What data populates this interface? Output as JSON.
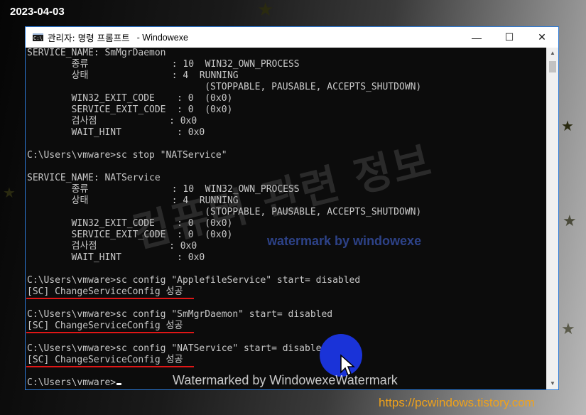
{
  "overlay": {
    "date": "2023-04-03",
    "watermark_korean": "컴퓨터 관련 정보",
    "watermark_blue": "watermark by windowexe",
    "watermark_bottom": "Watermarked by WindowexeWatermark",
    "site_url": "https://pcwindows.tistory.com"
  },
  "window": {
    "title": "관리자: 명령 프롬프트",
    "title_suffix": "- Windowexe",
    "icon": "cmd-icon",
    "controls": {
      "minimize": "—",
      "maximize": "☐",
      "close": "✕"
    }
  },
  "console": {
    "lines": [
      "SERVICE_NAME: SmMgrDaemon",
      "        종류               : 10  WIN32_OWN_PROCESS",
      "        상태               : 4  RUNNING",
      "                                (STOPPABLE, PAUSABLE, ACCEPTS_SHUTDOWN)",
      "        WIN32_EXIT_CODE    : 0  (0x0)",
      "        SERVICE_EXIT_CODE  : 0  (0x0)",
      "        검사점             : 0x0",
      "        WAIT_HINT          : 0x0",
      "",
      "C:\\Users\\vmware>sc stop \"NATService\"",
      "",
      "SERVICE_NAME: NATService",
      "        종류               : 10  WIN32_OWN_PROCESS",
      "        상태               : 4  RUNNING",
      "                                (STOPPABLE, PAUSABLE, ACCEPTS_SHUTDOWN)",
      "        WIN32_EXIT_CODE    : 0  (0x0)",
      "        SERVICE_EXIT_CODE  : 0  (0x0)",
      "        검사점             : 0x0",
      "        WAIT_HINT          : 0x0",
      "",
      "C:\\Users\\vmware>sc config \"ApplefileService\" start= disabled",
      "[SC] ChangeServiceConfig 성공",
      "",
      "C:\\Users\\vmware>sc config \"SmMgrDaemon\" start= disabled",
      "[SC] ChangeServiceConfig 성공",
      "",
      "C:\\Users\\vmware>sc config \"NATService\" start= disabled",
      "[SC] ChangeServiceConfig 성공",
      "",
      "C:\\Users\\vmware>"
    ]
  }
}
